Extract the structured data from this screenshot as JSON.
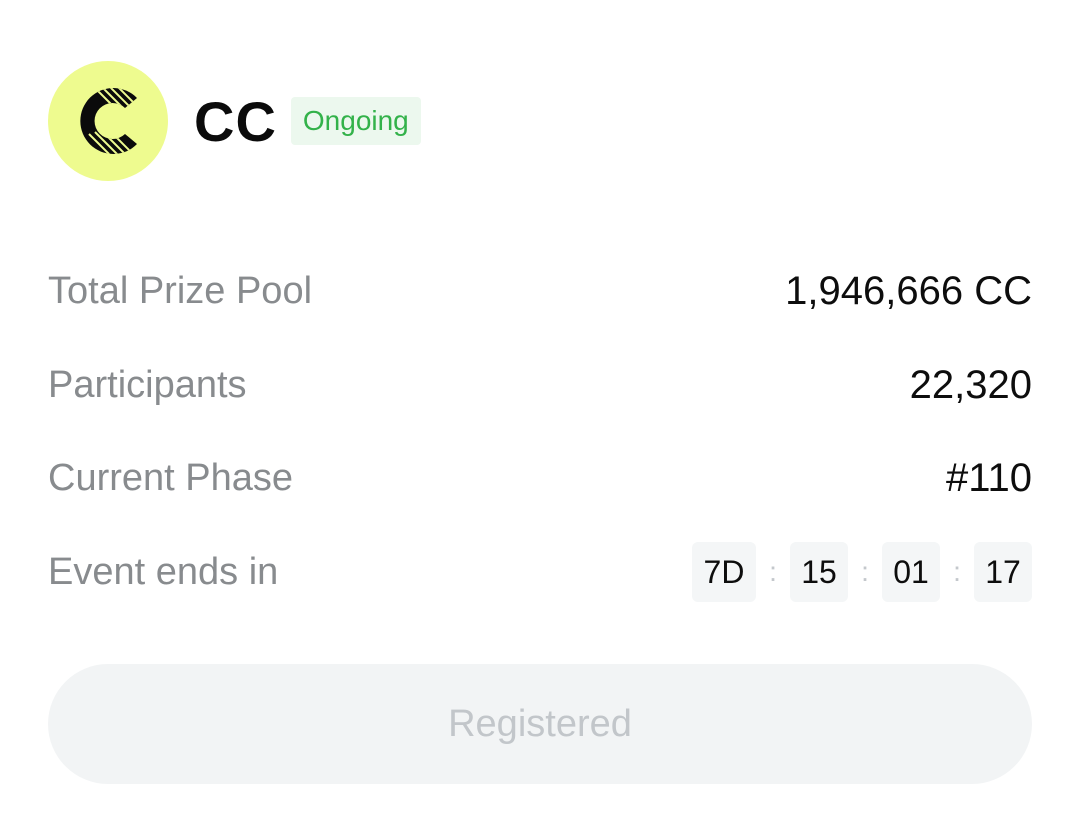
{
  "event": {
    "token_name": "CC",
    "status": "Ongoing",
    "logo_icon": "cc-logo-icon"
  },
  "stats": {
    "total_prize_pool_label": "Total Prize Pool",
    "total_prize_pool_value": "1,946,666 CC",
    "participants_label": "Participants",
    "participants_value": "22,320",
    "current_phase_label": "Current Phase",
    "current_phase_value": "#110",
    "event_ends_label": "Event ends in"
  },
  "countdown": {
    "days": "7D",
    "hours": "15",
    "minutes": "01",
    "seconds": "17",
    "separator": ":"
  },
  "actions": {
    "register_label": "Registered"
  },
  "colors": {
    "logo_bg": "#eefb8f",
    "status_text": "#33b24a",
    "status_bg": "#ecf8ee",
    "label_text": "#888b8e",
    "value_text": "#0d0d0d",
    "button_bg": "#f2f4f5",
    "button_text": "#c2c6ca"
  }
}
